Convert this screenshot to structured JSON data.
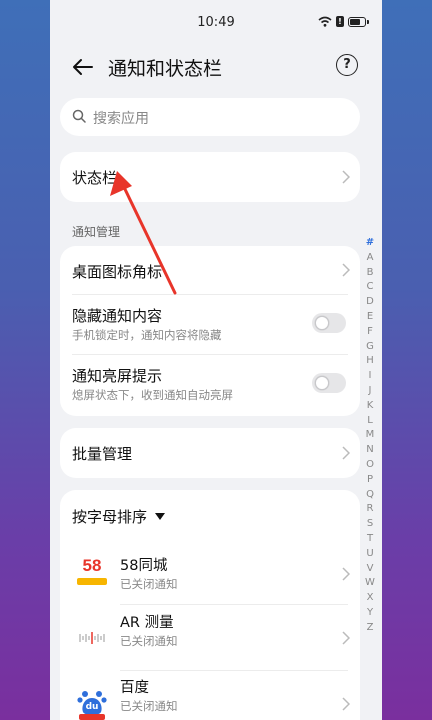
{
  "status_bar": {
    "time": "10:49",
    "sim_label": "!"
  },
  "header": {
    "title": "通知和状态栏",
    "help_label": "?"
  },
  "search": {
    "placeholder": "搜索应用"
  },
  "status_bar_item": {
    "label": "状态栏"
  },
  "notification_section": {
    "label": "通知管理",
    "items": [
      {
        "title": "桌面图标角标"
      },
      {
        "title": "隐藏通知内容",
        "subtitle": "手机锁定时，通知内容将隐藏",
        "enabled": false
      },
      {
        "title": "通知亮屏提示",
        "subtitle": "熄屏状态下，收到通知自动亮屏",
        "enabled": false
      }
    ]
  },
  "batch": {
    "label": "批量管理"
  },
  "sort": {
    "label": "按字母排序"
  },
  "apps": [
    {
      "name": "58同城",
      "status": "已关闭通知",
      "icon": "58-tongcheng-icon",
      "icon_text": "58"
    },
    {
      "name": "AR 测量",
      "status": "已关闭通知",
      "icon": "ar-measure-icon"
    },
    {
      "name": "百度",
      "status": "已关闭通知",
      "icon": "baidu-icon",
      "icon_text": "du"
    }
  ],
  "alphabet": [
    "#",
    "A",
    "B",
    "C",
    "D",
    "E",
    "F",
    "G",
    "H",
    "I",
    "J",
    "K",
    "L",
    "M",
    "N",
    "O",
    "P",
    "Q",
    "R",
    "S",
    "T",
    "U",
    "V",
    "W",
    "X",
    "Y",
    "Z"
  ],
  "colors": {
    "accent": "#2f6fdb",
    "arrow": "#e8352a",
    "background": "#f1f2f5"
  }
}
